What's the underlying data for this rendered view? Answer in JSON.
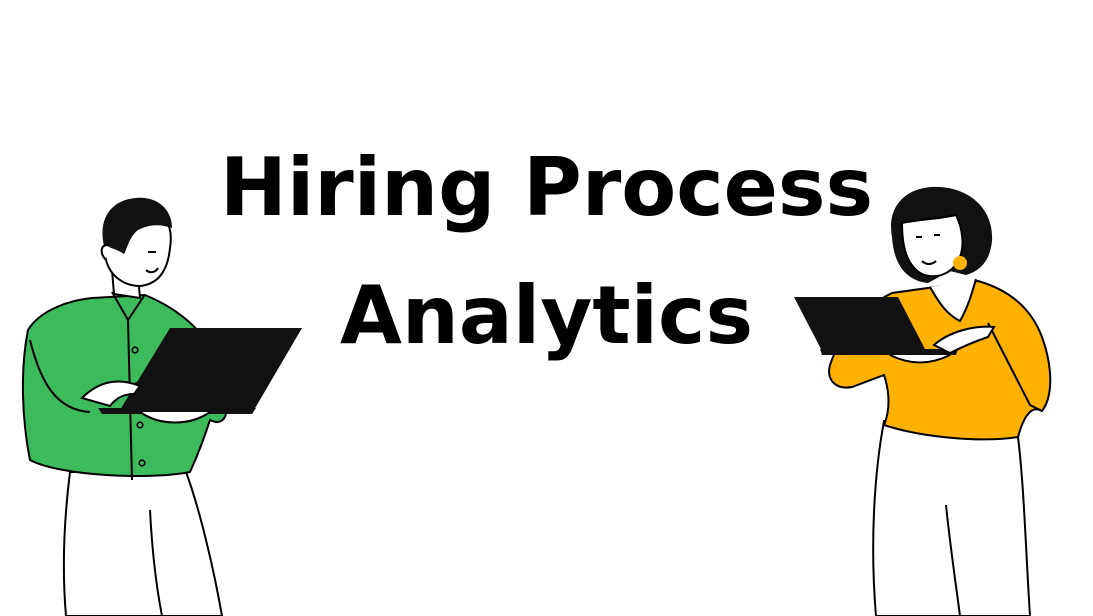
{
  "title": {
    "line1": "Hiring Process",
    "line2": "Analytics"
  },
  "illustrations": {
    "left_person": {
      "icon": "man-with-laptop-icon",
      "shirt_color": "#3dba5b"
    },
    "right_person": {
      "icon": "woman-with-laptop-icon",
      "shirt_color": "#ffb100"
    },
    "laptop_color": "#111111"
  },
  "colors": {
    "background": "#ffffff",
    "text": "#000000"
  }
}
